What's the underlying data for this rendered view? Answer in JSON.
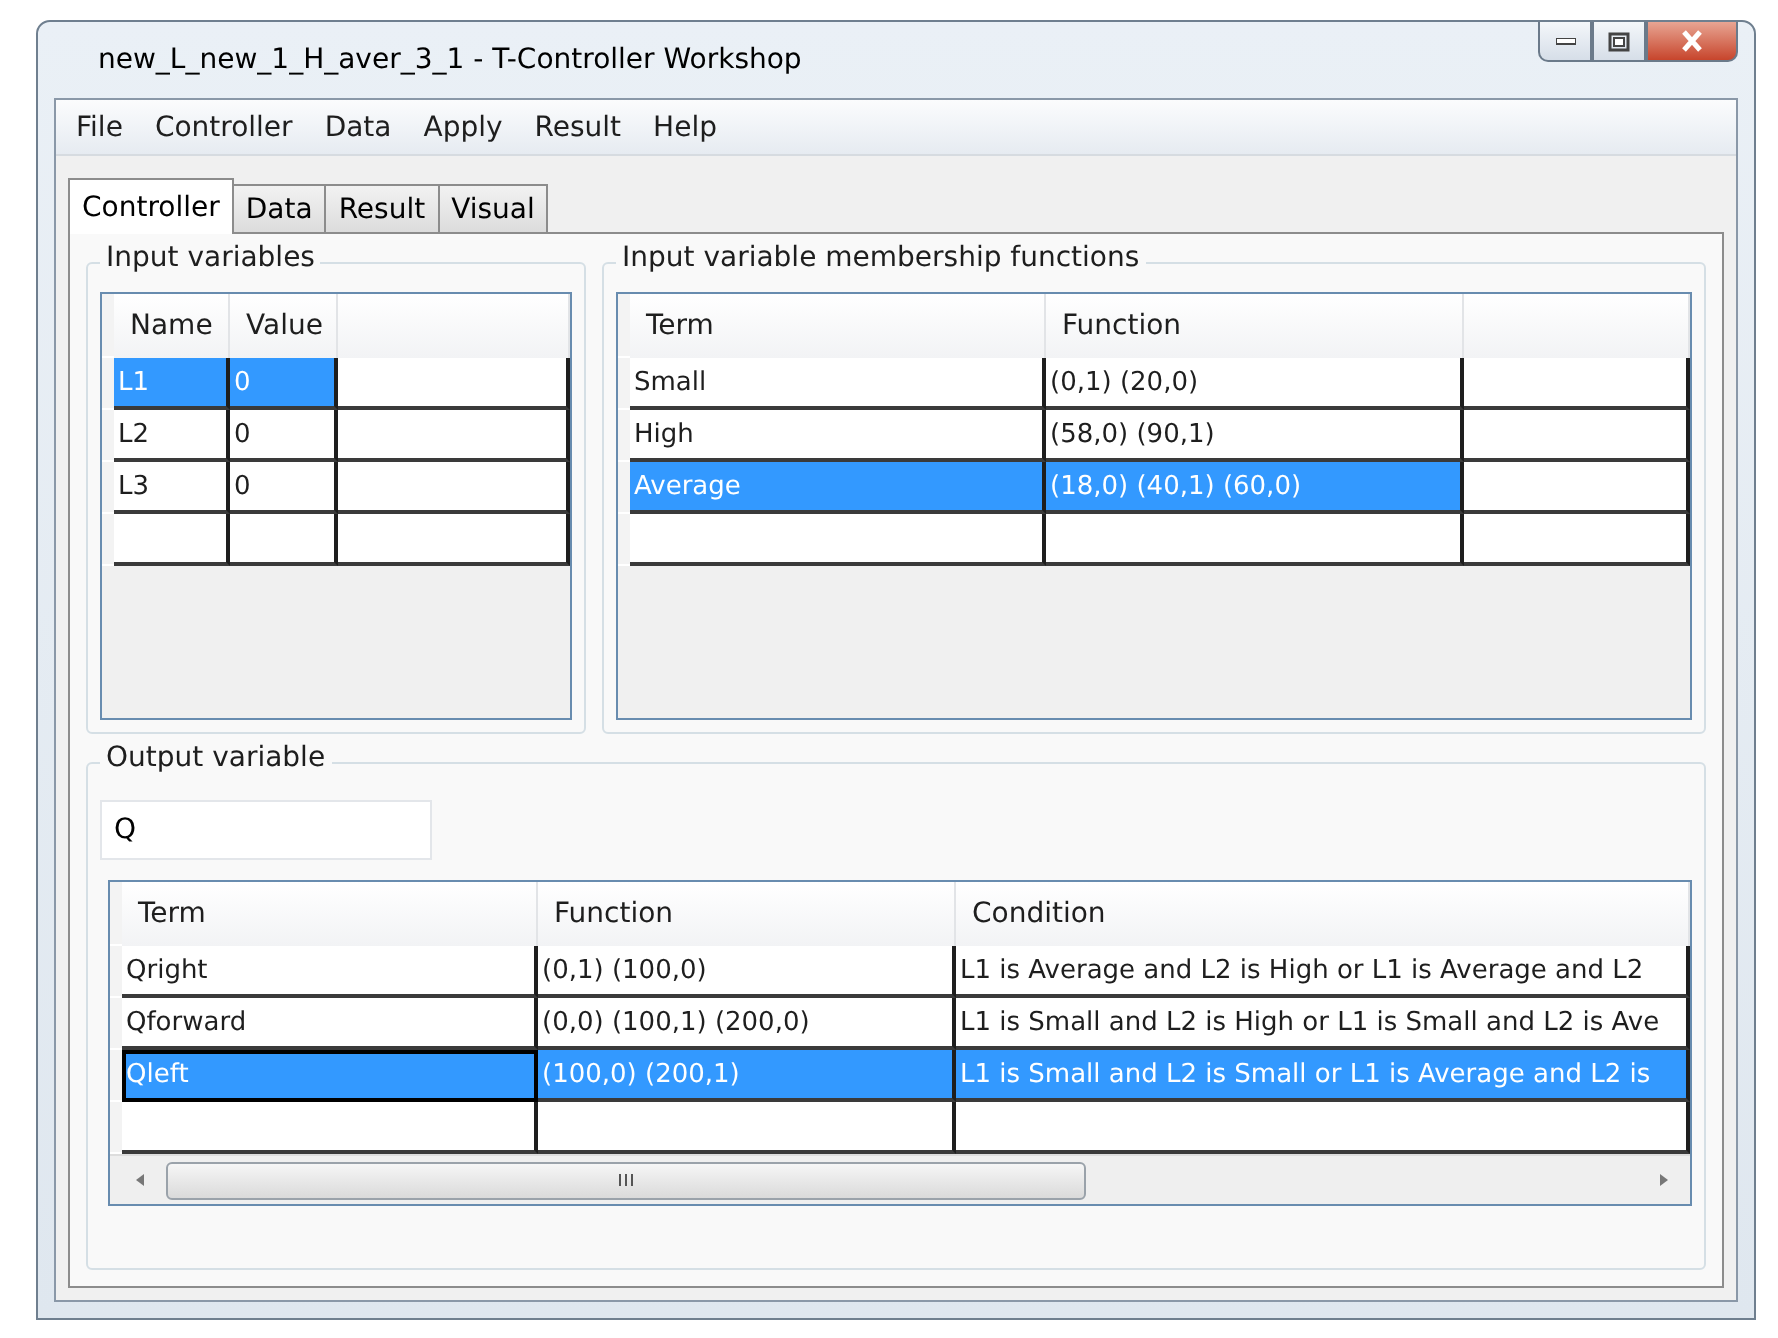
{
  "window": {
    "title": "new_L_new_1_H_aver_3_1 - T-Controller Workshop"
  },
  "menu": [
    "File",
    "Controller",
    "Data",
    "Apply",
    "Result",
    "Help"
  ],
  "tabs": [
    {
      "label": "Controller",
      "selected": true
    },
    {
      "label": "Data",
      "selected": false
    },
    {
      "label": "Result",
      "selected": false
    },
    {
      "label": "Visual",
      "selected": false
    }
  ],
  "input_variables": {
    "title": "Input variables",
    "columns": [
      "Name",
      "Value"
    ],
    "rows": [
      {
        "cells": [
          "L1",
          "0"
        ],
        "selected": true
      },
      {
        "cells": [
          "L2",
          "0"
        ],
        "selected": false
      },
      {
        "cells": [
          "L3",
          "0"
        ],
        "selected": false
      }
    ]
  },
  "membership_functions": {
    "title": "Input variable membership functions",
    "columns": [
      "Term",
      "Function"
    ],
    "rows": [
      {
        "cells": [
          "Small",
          "(0,1) (20,0)"
        ],
        "selected": false
      },
      {
        "cells": [
          "High",
          "(58,0) (90,1)"
        ],
        "selected": false
      },
      {
        "cells": [
          "Average",
          "(18,0) (40,1) (60,0)"
        ],
        "selected": true
      }
    ]
  },
  "output_variable": {
    "title": "Output variable",
    "name": "Q",
    "columns": [
      "Term",
      "Function",
      "Condition"
    ],
    "rows": [
      {
        "cells": [
          "Qright",
          "(0,1) (100,0)",
          "L1 is Average and L2 is High or L1 is Average and L2"
        ],
        "selected": false
      },
      {
        "cells": [
          "Qforward",
          "(0,0) (100,1) (200,0)",
          "L1 is Small and L2 is High or L1 is Small and L2 is Ave"
        ],
        "selected": false
      },
      {
        "cells": [
          "Qleft",
          "(100,0) (200,1)",
          "L1 is Small and L2 is Small or L1 is Average and L2 is"
        ],
        "selected": true
      }
    ]
  }
}
